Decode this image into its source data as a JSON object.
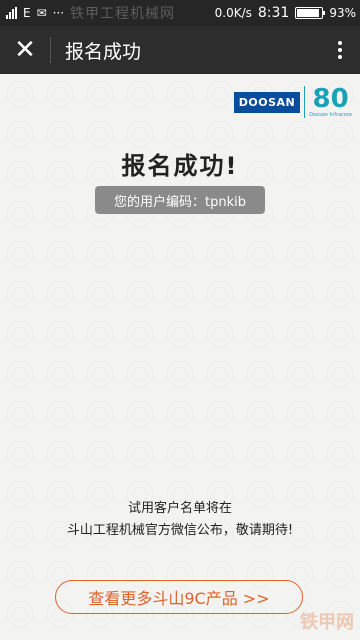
{
  "status_bar": {
    "carrier_label": "E",
    "network_speed": "0.0K/s",
    "time": "8:31",
    "battery_text": "93%",
    "battery_level": 0.93,
    "watermark": "铁甲工程机械网"
  },
  "header": {
    "title": "报名成功"
  },
  "logo": {
    "brand": "DOOSAN",
    "anniversary": "80",
    "anniversary_sub": "Doosan Infracore"
  },
  "main": {
    "success_title": "报名成功!",
    "user_code_text": "您的用户编码：tpnkib",
    "notice_line1": "试用客户名单将在",
    "notice_line2": "斗山工程机械官方微信公布，敬请期待!",
    "cta_label": "查看更多斗山9C产品 >>",
    "watermark": "铁甲网"
  }
}
